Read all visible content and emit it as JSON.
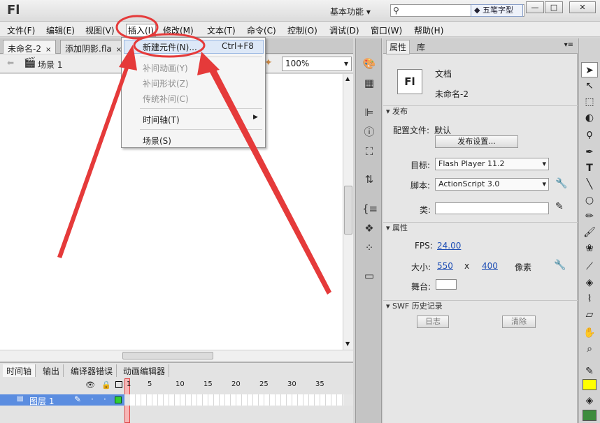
{
  "app": {
    "logo": "Fl",
    "workspace": "基本功能",
    "search_placeholder": "",
    "ime_badge": "五笔字型"
  },
  "window_buttons": [
    "—",
    "□",
    "✕"
  ],
  "menubar": [
    "文件(F)",
    "编辑(E)",
    "视图(V)",
    "插入(I)",
    "修改(M)",
    "文本(T)",
    "命令(C)",
    "控制(O)",
    "调试(D)",
    "窗口(W)",
    "帮助(H)"
  ],
  "doc_tabs": [
    {
      "label": "未命名-2",
      "close": "×"
    },
    {
      "label": "添加阴影.fla",
      "close": "×"
    }
  ],
  "scene": {
    "label": "场景 1",
    "zoom": "100%"
  },
  "insert_menu": {
    "new_symbol": "新建元件(N)...",
    "new_symbol_shortcut": "Ctrl+F8",
    "motion_tween": "补间动画(Y)",
    "shape_tween": "补间形状(Z)",
    "classic_tween": "传统补间(C)",
    "timeline": "时间轴(T)",
    "scene": "场景(S)"
  },
  "timeline": {
    "tabs": [
      "时间轴",
      "输出",
      "编译器错误",
      "动画编辑器"
    ],
    "frame_numbers": [
      "1",
      "5",
      "10",
      "15",
      "20",
      "25",
      "30",
      "35"
    ],
    "layer_name": "图层 1"
  },
  "properties": {
    "tabs": [
      "属性",
      "库"
    ],
    "doc_type": "文档",
    "doc_name": "未命名-2",
    "doc_icon": "Fl",
    "publish_header": "发布",
    "profile_label": "配置文件:",
    "profile_value": "默认",
    "publish_settings": "发布设置...",
    "target_label": "目标:",
    "target_value": "Flash Player 11.2",
    "script_label": "脚本:",
    "script_value": "ActionScript 3.0",
    "class_label": "类:",
    "props_header": "属性",
    "fps_label": "FPS:",
    "fps_value": "24.00",
    "size_label": "大小:",
    "width": "550",
    "x": "x",
    "height": "400",
    "unit": "像素",
    "stage_label": "舞台:",
    "swf_header": "SWF 历史记录",
    "log_button": "日志",
    "clear_button": "清除"
  },
  "colors": {
    "stroke_swatch": "#000000",
    "fill_swatch": "#ffff00",
    "annotation": "#e53a3a"
  }
}
